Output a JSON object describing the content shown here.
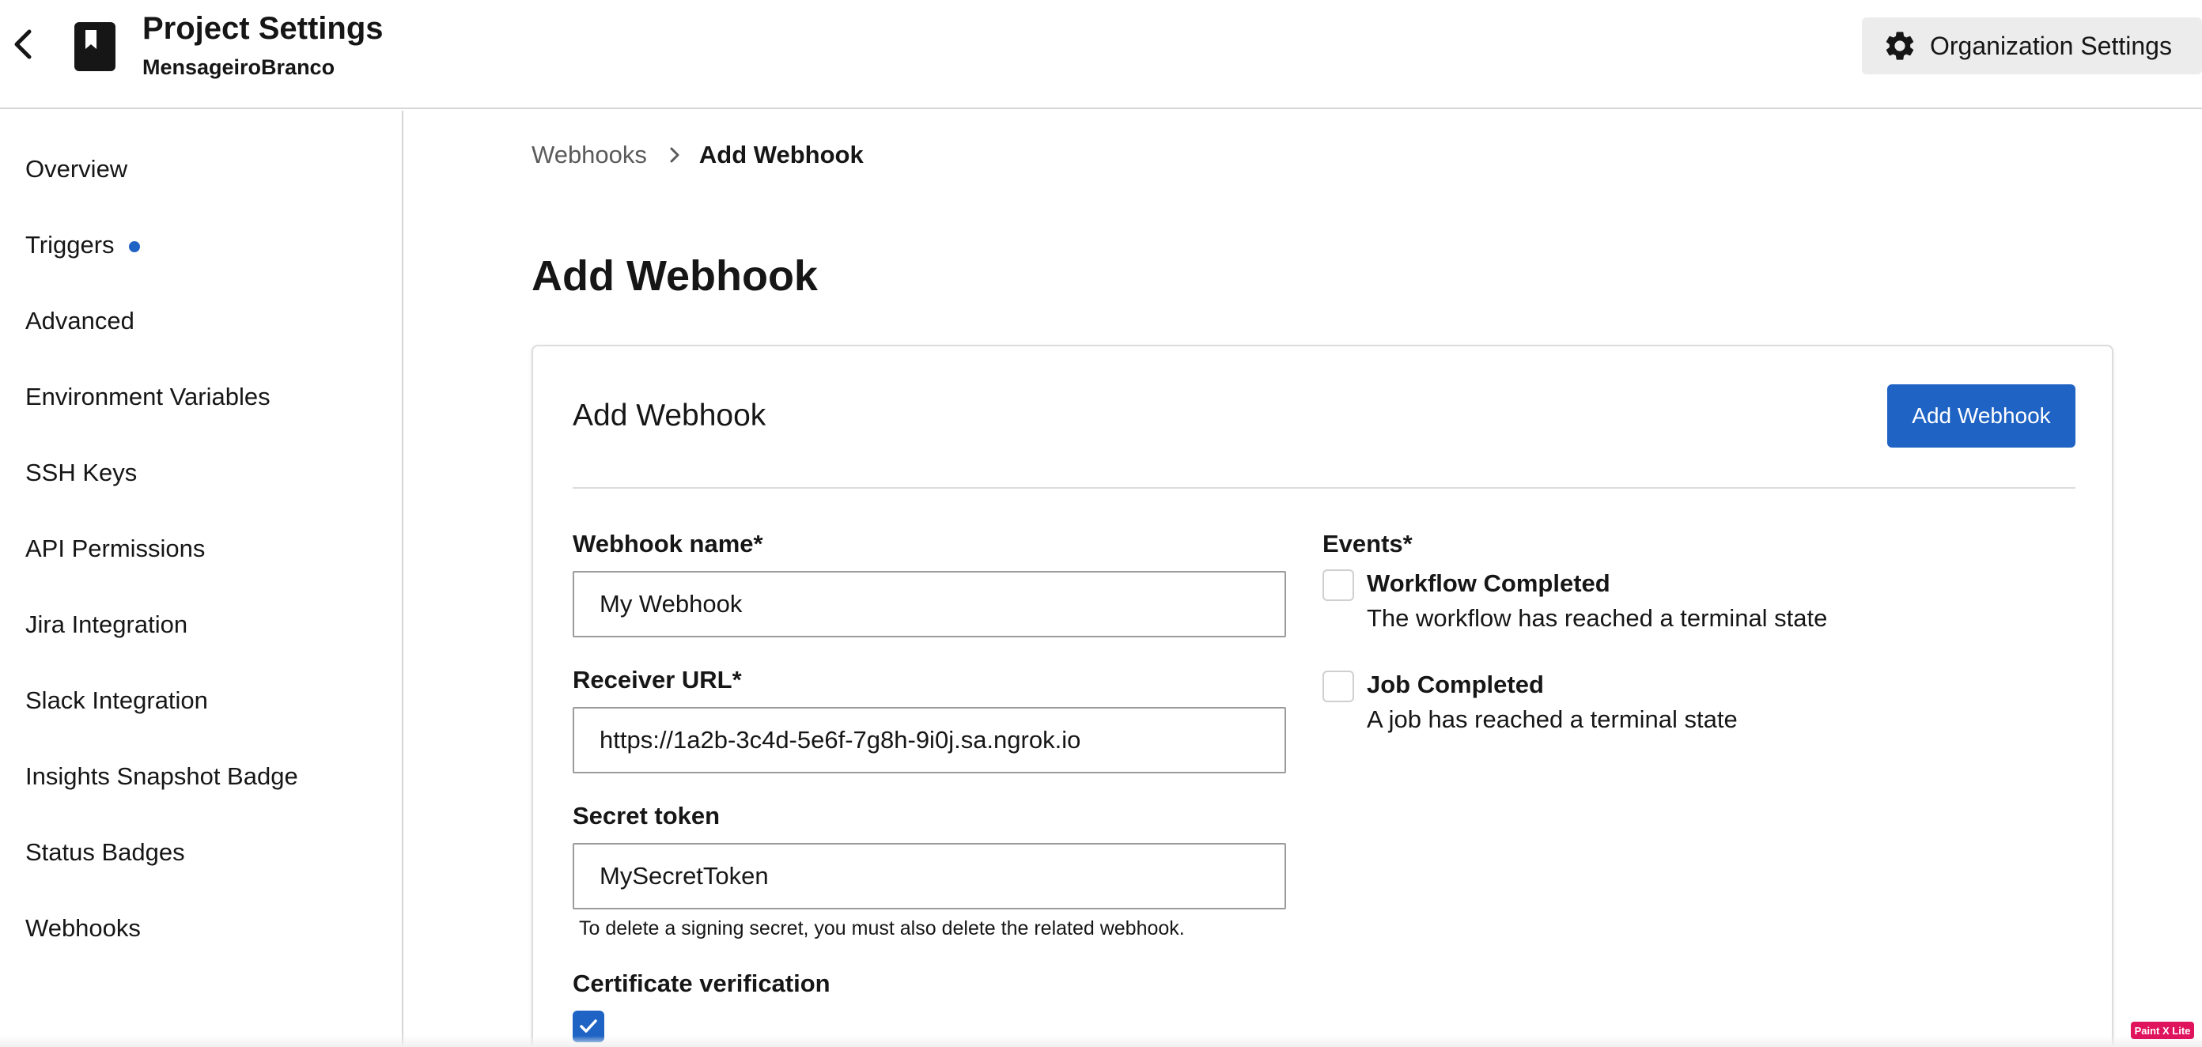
{
  "header": {
    "title": "Project Settings",
    "subtitle": "MensageiroBranco",
    "back_icon": "chevron-left-icon",
    "project_icon": "bookmark-book-icon",
    "org_settings_label": "Organization Settings",
    "org_settings_icon": "gear-icon"
  },
  "sidebar": {
    "items": [
      {
        "label": "Overview"
      },
      {
        "label": "Triggers",
        "has_dot": true
      },
      {
        "label": "Advanced"
      },
      {
        "label": "Environment Variables"
      },
      {
        "label": "SSH Keys"
      },
      {
        "label": "API Permissions"
      },
      {
        "label": "Jira Integration"
      },
      {
        "label": "Slack Integration"
      },
      {
        "label": "Insights Snapshot Badge"
      },
      {
        "label": "Status Badges"
      },
      {
        "label": "Webhooks"
      }
    ],
    "dot_color": "#1f63c4"
  },
  "breadcrumb": {
    "parent": "Webhooks",
    "current": "Add Webhook"
  },
  "page": {
    "title": "Add Webhook"
  },
  "form": {
    "card_title": "Add Webhook",
    "submit_label": "Add Webhook",
    "webhook_name": {
      "label": "Webhook name*",
      "value": "My Webhook"
    },
    "receiver_url": {
      "label": "Receiver URL*",
      "value": "https://1a2b-3c4d-5e6f-7g8h-9i0j.sa.ngrok.io"
    },
    "secret_token": {
      "label": "Secret token",
      "value": "MySecretToken",
      "help": "To delete a signing secret, you must also delete the related webhook."
    },
    "certificate_verification": {
      "label": "Certificate verification",
      "checked": true
    },
    "events": {
      "label": "Events*",
      "items": [
        {
          "title": "Workflow Completed",
          "description": "The workflow has reached a terminal state",
          "checked": false
        },
        {
          "title": "Job Completed",
          "description": "A job has reached a terminal state",
          "checked": false
        }
      ]
    }
  },
  "extension_badge": "Paint X Lite",
  "colors": {
    "primary": "#1f63c4",
    "border": "#d6d6d6",
    "org_button_bg": "#ececec"
  }
}
